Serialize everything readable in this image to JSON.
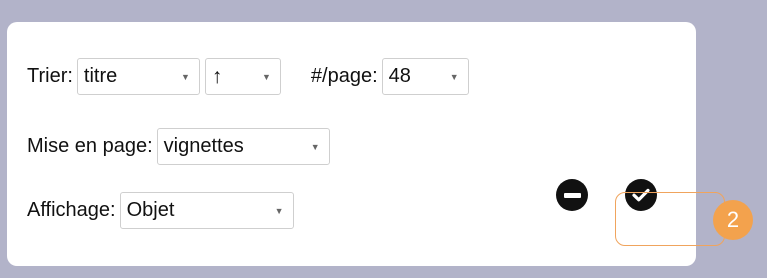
{
  "sort": {
    "label": "Trier:",
    "field_value": "titre",
    "direction_value": "↑"
  },
  "per_page": {
    "label": "#/page:",
    "value": "48"
  },
  "layout": {
    "label": "Mise en page:",
    "value": "vignettes"
  },
  "display": {
    "label": "Affichage:",
    "value": "Objet"
  },
  "icons": {
    "caret": "▼",
    "minus_button": "minus-circle-icon",
    "check_button": "check-circle-icon"
  },
  "callout": {
    "number": "2",
    "color": "#f3a24d"
  },
  "colors": {
    "background": "#b2b3c9",
    "panel": "#ffffff",
    "button": "#111111"
  }
}
